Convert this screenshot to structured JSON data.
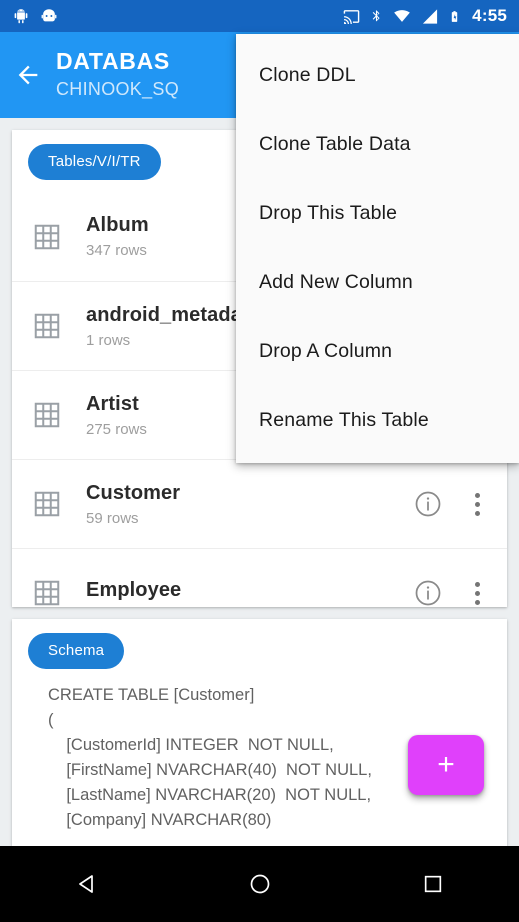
{
  "status_bar": {
    "time": "4:55",
    "icons": [
      "android-robot-icon",
      "android-head-icon",
      "cast-icon",
      "bluetooth-icon",
      "wifi-icon",
      "cellular-signal-icon",
      "battery-charging-icon"
    ]
  },
  "app_bar": {
    "back_icon": "arrow-back-icon",
    "title": "DATABAS",
    "subtitle": "CHINOOK_SQ"
  },
  "list_card": {
    "chip_label": "Tables/V/I/TR",
    "rows": [
      {
        "name": "Album",
        "rows": "347 rows"
      },
      {
        "name": "android_metada",
        "rows": "1 rows"
      },
      {
        "name": "Artist",
        "rows": "275 rows"
      },
      {
        "name": "Customer",
        "rows": "59 rows"
      },
      {
        "name": "Employee",
        "rows": ""
      }
    ]
  },
  "schema_card": {
    "chip_label": "Schema",
    "sql": "CREATE TABLE [Customer]\n(\n    [CustomerId] INTEGER  NOT NULL,\n    [FirstName] NVARCHAR(40)  NOT NULL,\n    [LastName] NVARCHAR(20)  NOT NULL,\n    [Company] NVARCHAR(80)"
  },
  "fab": {
    "label": "+"
  },
  "menu": {
    "items": [
      {
        "label": "Clone DDL"
      },
      {
        "label": "Clone Table Data"
      },
      {
        "label": "Drop This Table"
      },
      {
        "label": "Add New Column"
      },
      {
        "label": "Drop A Column"
      },
      {
        "label": "Rename This Table"
      }
    ]
  },
  "nav_bar": {
    "back": "nav-back-triangle-icon",
    "home": "nav-home-circle-icon",
    "recents": "nav-recents-square-icon"
  },
  "colors": {
    "status_bar": "#1565c0",
    "app_bar": "#2196f3",
    "chip": "#1e7fd4",
    "fab": "#e040fb",
    "page_bg": "#eceff1"
  }
}
